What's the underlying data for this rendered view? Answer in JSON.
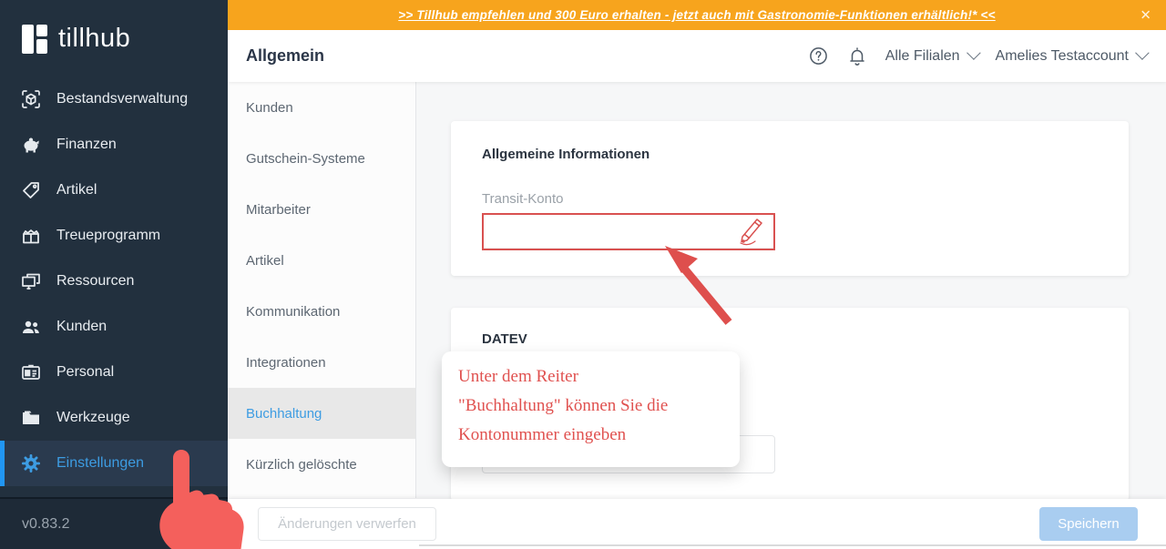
{
  "banner": {
    "text": ">> Tillhub empfehlen und 300 Euro erhalten - jetzt auch mit Gastronomie-Funktionen erhältlich!* <<",
    "close_label": "✕",
    "bg_color": "#f7a41d"
  },
  "sidebar": {
    "logo_text": "tillhub",
    "items": [
      {
        "label": "Bestandsverwaltung",
        "icon": "inventory-scan-icon",
        "active": false
      },
      {
        "label": "Finanzen",
        "icon": "piggy-bank-icon",
        "active": false
      },
      {
        "label": "Artikel",
        "icon": "price-tag-icon",
        "active": false
      },
      {
        "label": "Treueprogramm",
        "icon": "gift-icon",
        "active": false
      },
      {
        "label": "Ressourcen",
        "icon": "monitors-icon",
        "active": false
      },
      {
        "label": "Kunden",
        "icon": "people-icon",
        "active": false
      },
      {
        "label": "Personal",
        "icon": "id-card-icon",
        "active": false
      },
      {
        "label": "Werkzeuge",
        "icon": "folder-icon",
        "active": false
      },
      {
        "label": "Einstellungen",
        "icon": "gear-icon",
        "active": true
      }
    ],
    "active_color": "#3d9ce2",
    "version": "v0.83.2"
  },
  "header": {
    "title": "Allgemein",
    "help_icon": "?",
    "branch_filter": "Alle Filialen",
    "account": "Amelies Testaccount"
  },
  "subnav": {
    "items": [
      "Kunden",
      "Gutschein-Systeme",
      "Mitarbeiter",
      "Artikel",
      "Kommunikation",
      "Integrationen",
      "Buchhaltung",
      "Kürzlich gelöschte"
    ],
    "active": "Buchhaltung"
  },
  "main": {
    "card_general": {
      "title": "Allgemeine Informationen",
      "field_label": "Transit-Konto",
      "field_value": "",
      "highlight_color": "#d95150"
    },
    "card_datev": {
      "title": "DATEV"
    },
    "callout": {
      "line1": "Unter dem Reiter",
      "line2": "\"Buchhaltung\" können Sie die",
      "line3": "Kontonummer eingeben",
      "text_color": "#e0514f"
    }
  },
  "footer": {
    "discard_label": "Änderungen verwerfen",
    "save_label": "Speichern",
    "save_color": "#a9cdf0"
  }
}
